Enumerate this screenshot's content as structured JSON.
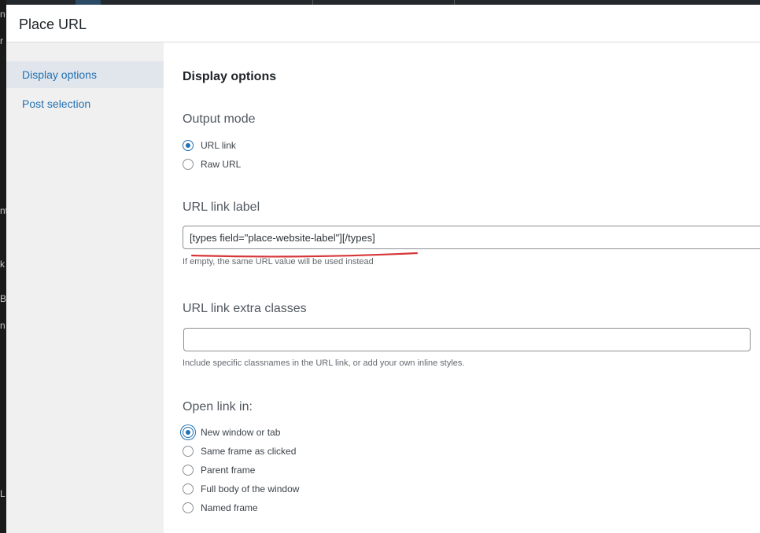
{
  "dialog": {
    "title": "Place URL"
  },
  "background_fragments": [
    "n",
    "r",
    "nt",
    "k",
    "B",
    "n",
    "L"
  ],
  "sidebar": {
    "items": [
      {
        "label": "Display options",
        "active": true
      },
      {
        "label": "Post selection",
        "active": false
      }
    ]
  },
  "main": {
    "section_title": "Display options",
    "output_mode": {
      "label": "Output mode",
      "options": [
        {
          "label": "URL link",
          "checked": true
        },
        {
          "label": "Raw URL",
          "checked": false
        }
      ]
    },
    "url_link_label": {
      "label": "URL link label",
      "value": "[types field=\"place-website-label\"][/types]",
      "help": "If empty, the same URL value will be used instead"
    },
    "url_link_extra_classes": {
      "label": "URL link extra classes",
      "value": "",
      "help": "Include specific classnames in the URL link, or add your own inline styles."
    },
    "open_link_in": {
      "label": "Open link in:",
      "options": [
        {
          "label": "New window or tab",
          "checked": true
        },
        {
          "label": "Same frame as clicked",
          "checked": false
        },
        {
          "label": "Parent frame",
          "checked": false
        },
        {
          "label": "Full body of the window",
          "checked": false
        },
        {
          "label": "Named frame",
          "checked": false
        }
      ]
    }
  },
  "colors": {
    "accent": "#2271b1",
    "annotation": "#d63638"
  }
}
